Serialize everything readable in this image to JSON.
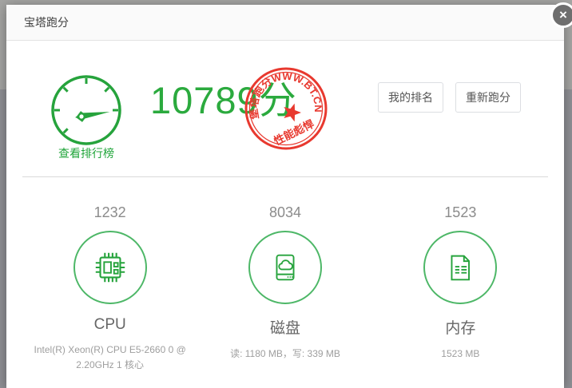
{
  "dialog": {
    "title": "宝塔跑分",
    "close_icon": "×"
  },
  "score_panel": {
    "rank_link": "查看排行榜",
    "score": "10789",
    "score_unit": "分",
    "stamp": {
      "arc_text": "堡塔跑分WWW.BT.CN",
      "slogan": "性能彪悍"
    },
    "buttons": {
      "my_rank": "我的排名",
      "rerun": "重新跑分"
    }
  },
  "stats": {
    "items": [
      {
        "value": "1232",
        "label": "CPU",
        "desc": "Intel(R) Xeon(R) CPU E5-2660 0 @ 2.20GHz 1 核心",
        "icon": "cpu-chip-icon"
      },
      {
        "value": "8034",
        "label": "磁盘",
        "desc": "读: 1180 MB，写: 339 MB",
        "icon": "disk-drive-icon"
      },
      {
        "value": "1523",
        "label": "内存",
        "desc": "1523 MB",
        "icon": "memory-document-icon"
      }
    ]
  },
  "colors": {
    "green": "#20a53a",
    "score_green": "#2baa3e",
    "circle_green": "#4db767",
    "stamp_red": "#e8392f",
    "muted_text": "#9e9e9e",
    "backdrop": "#8f9095"
  }
}
